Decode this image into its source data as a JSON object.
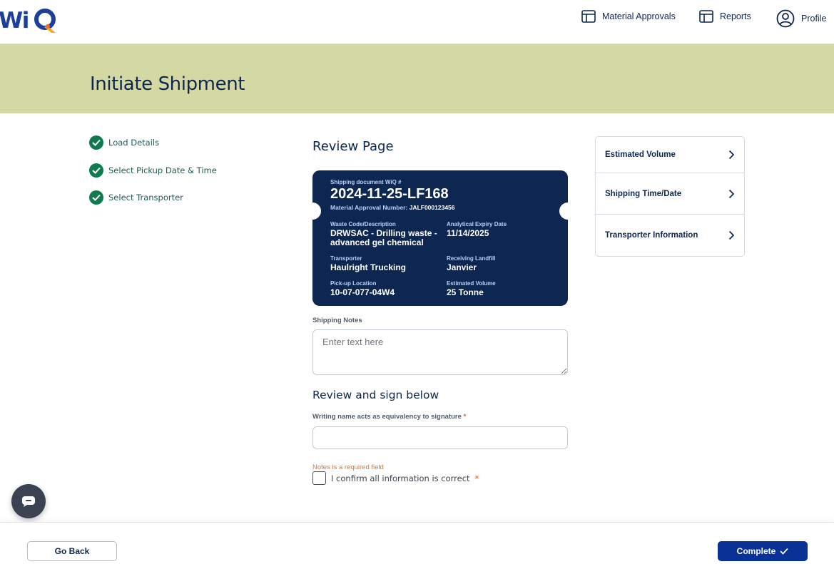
{
  "brand": {
    "logo_text": "WiQ",
    "accent": "#1d3f9b",
    "logo_secondary": "#f5a623"
  },
  "nav": {
    "material_approvals": "Material Approvals",
    "reports": "Reports",
    "profile": "Profile"
  },
  "page": {
    "title": "Initiate Shipment",
    "header_bg": "#d4d8a3"
  },
  "steps": [
    {
      "label": "Load Details",
      "status": "complete"
    },
    {
      "label": "Select Pickup Date & Time",
      "status": "complete"
    },
    {
      "label": "Select Transporter",
      "status": "complete"
    }
  ],
  "review": {
    "title": "Review Page",
    "ticket": {
      "doc_label": "Shipping document WiQ #",
      "doc_number": "2024-11-25-LF168",
      "approval_label": "Material Approval Number:",
      "approval_number": "JALF000123456",
      "waste_label": "Waste Code/Description",
      "waste_value": "DRWSAC - Drilling waste - advanced gel chemical",
      "expiry_label": "Analytical Expiry Date",
      "expiry_value": "11/14/2025",
      "transporter_label": "Transporter",
      "transporter_value": "Haulright Trucking",
      "landfill_label": "Receiving Landfill",
      "landfill_value": "Janvier",
      "pickup_label": "Pick-up Location",
      "pickup_value": "10-07-077-04W4",
      "volume_label": "Estimated Volume",
      "volume_value": "25 Tonne"
    },
    "notes_label": "Shipping Notes",
    "notes_placeholder": "Enter text here",
    "notes_value": "",
    "sign_title": "Review and sign below",
    "sign_label": "Writing name acts as equivalency to signature",
    "required_mark": "*",
    "sign_value": "",
    "error_text": "Notes is a required field",
    "confirm_label": "I confirm all information is correct",
    "confirm_checked": false
  },
  "summary": [
    {
      "label": "Estimated Volume"
    },
    {
      "label": "Shipping Time/Date"
    },
    {
      "label": "Transporter Information"
    }
  ],
  "footer": {
    "back_label": "Go Back",
    "complete_label": "Complete"
  },
  "colors": {
    "navy": "#0d2750",
    "step_green": "#0f7a4e",
    "primary_button": "#0a3196",
    "error": "#e0752a"
  }
}
